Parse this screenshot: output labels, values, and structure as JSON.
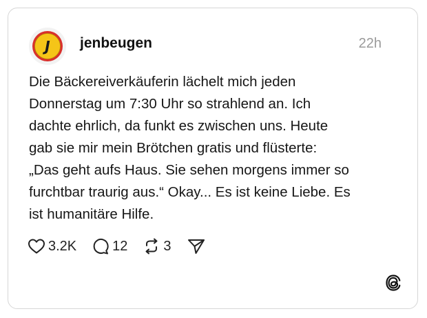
{
  "post": {
    "avatar_letter": "J",
    "username": "jenbeugen",
    "time": "22h",
    "text": "Die Bäckereiverkäuferin lächelt mich jeden\nDonnerstag um 7:30 Uhr so strahlend an. Ich\ndachte ehrlich, da funkt es zwischen uns. Heute\ngab sie mir mein Brötchen gratis und flüsterte:\n„Das geht aufs Haus. Sie sehen morgens immer so\nfurchtbar traurig aus.“ Okay... Es ist keine Liebe. Es\nist humanitäre Hilfe."
  },
  "actions": {
    "likes": "3.2K",
    "replies": "12",
    "reposts": "3"
  },
  "icons": {
    "like": "heart-icon",
    "reply": "comment-bubble-icon",
    "repost": "repost-arrows-icon",
    "share": "paper-plane-icon",
    "brand": "threads-logo-icon"
  },
  "colors": {
    "avatar_ring": "#d9302b",
    "avatar_fill": "#f5c518",
    "text": "#161616",
    "muted": "#9a9a9a",
    "border": "#d6d6d6"
  }
}
